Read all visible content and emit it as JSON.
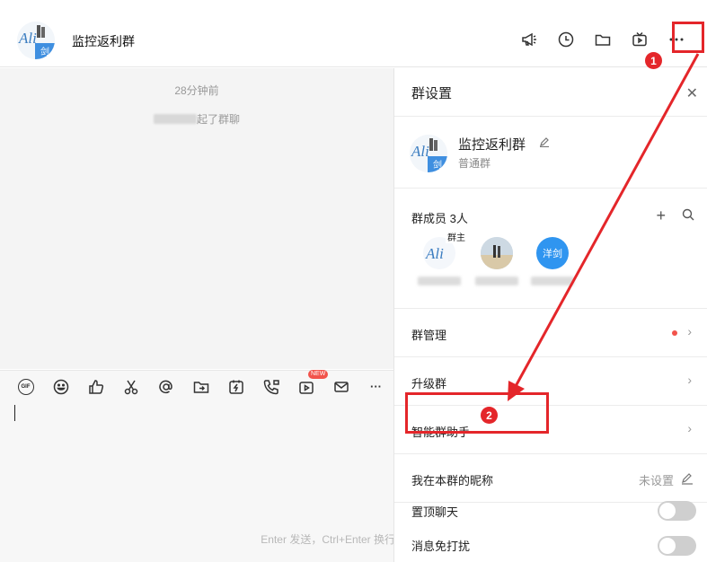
{
  "window": {
    "minimize": "—",
    "maximize": "☐",
    "close": "✕"
  },
  "header": {
    "group_name": "监控返利群",
    "avatar_text": "Ali",
    "avatar_sub": "剑",
    "icons": [
      "announcement-icon",
      "history-icon",
      "folder-icon",
      "live-icon",
      "more-icon"
    ]
  },
  "chat": {
    "timestamp": "28分钟前",
    "system_message": "起了群聊"
  },
  "toolbar": {
    "gif_label": "GIF",
    "new_badge": "NEW",
    "more": "···"
  },
  "input": {
    "hint": "Enter 发送，Ctrl+Enter 换行"
  },
  "panel": {
    "title": "群设置",
    "close": "✕",
    "group_name": "监控返利群",
    "group_type": "普通群",
    "members_label": "群成员 3人",
    "owner_tag": "群主",
    "member3_avatar": "洋剑",
    "rows": {
      "manage": "群管理",
      "upgrade": "升级群",
      "assistant": "智能群助手",
      "nickname": "我在本群的昵称",
      "nickname_value": "未设置",
      "pin": "置顶聊天",
      "mute": "消息免打扰"
    },
    "chevron": "›"
  },
  "annotations": {
    "step1": "1",
    "step2": "2"
  },
  "colors": {
    "annotation": "#e4262a",
    "badge": "#f2534b",
    "member_blue": "#2f95f0"
  }
}
